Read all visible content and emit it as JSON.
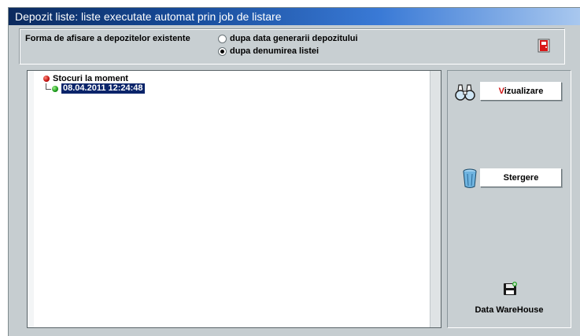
{
  "window": {
    "title": "Depozit liste: liste executate automat prin job de listare"
  },
  "options": {
    "label": "Forma de afisare a depozitelor existente",
    "radios": [
      {
        "label": "dupa data generarii depozitului",
        "selected": false
      },
      {
        "label": "dupa denumirea listei",
        "selected": true
      }
    ],
    "exit_icon": "exit-door-icon"
  },
  "tree": {
    "root_label": "Stocuri  la moment",
    "root_icon": "red-bullet-icon",
    "child_label": "08.04.2011 12:24:48",
    "child_icon": "green-bullet-icon",
    "child_selected": true
  },
  "actions": {
    "view_hotkey": "V",
    "view_rest": "izualizare",
    "view_icon": "binoculars-icon",
    "delete_label": "Stergere",
    "delete_icon": "trash-bin-icon",
    "dw_label": "Data WareHouse",
    "dw_icon": "floppy-save-icon"
  },
  "colors": {
    "title_start": "#0b2a5e",
    "title_end": "#a9c8ef",
    "selection": "#0a246a",
    "hotkey": "#d01010"
  }
}
